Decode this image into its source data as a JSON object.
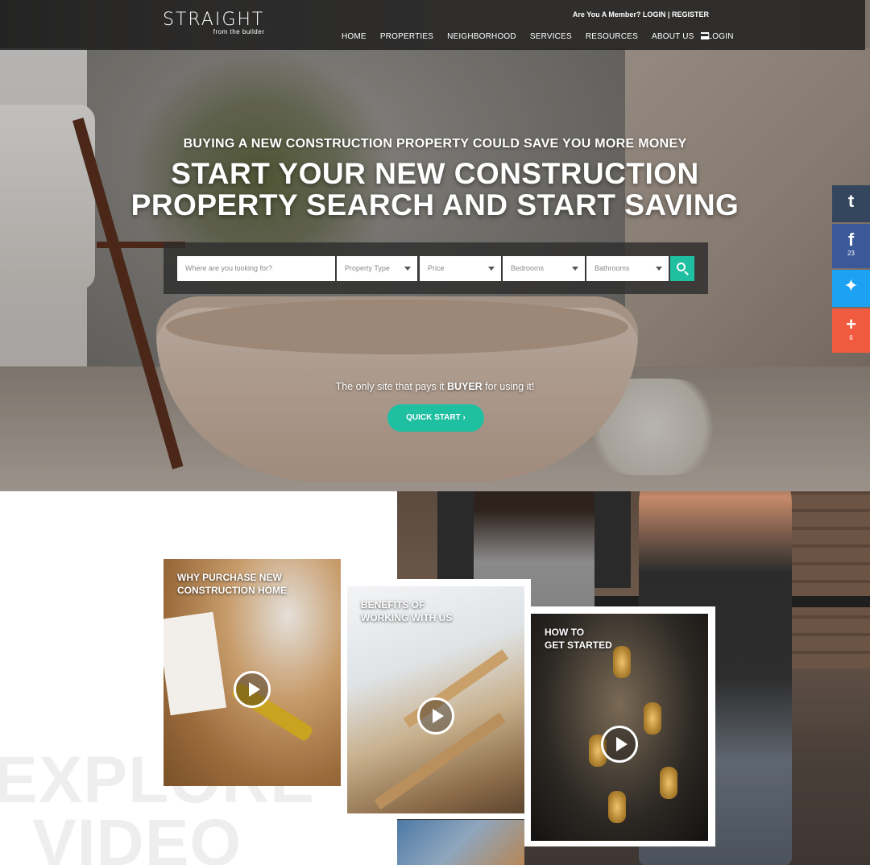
{
  "header": {
    "logo_word": "STRAIGHT",
    "logo_tagline": "from the builder",
    "member_prompt": "Are You A Member?",
    "login_link": "LOGIN",
    "separator": "|",
    "register_link": "REGISTER",
    "nav": [
      "HOME",
      "PROPERTIES",
      "NEIGHBORHOOD",
      "SERVICES",
      "RESOURCES",
      "ABOUT US",
      "LOGIN"
    ]
  },
  "hero": {
    "subtitle": "BUYING A NEW CONSTRUCTION PROPERTY COULD SAVE YOU MORE MONEY",
    "title_line1": "START YOUR NEW CONSTRUCTION",
    "title_line2": "PROPERTY SEARCH AND START SAVING",
    "promo_pre": "The only site that pays it ",
    "promo_bold": "BUYER",
    "promo_post": " for using it!",
    "cta": "QUICK START ›"
  },
  "search": {
    "location_placeholder": "Where are you looking for?",
    "property_type": "Property Type",
    "price": "Price",
    "bedrooms": "Bedrooms",
    "bathrooms": "Bathrooms",
    "button_icon": "search-icon"
  },
  "social": [
    {
      "name": "tumblr",
      "glyph": "t",
      "count": ""
    },
    {
      "name": "facebook",
      "glyph": "f",
      "count": "23"
    },
    {
      "name": "twitter",
      "glyph": "✦",
      "count": ""
    },
    {
      "name": "share",
      "glyph": "+",
      "count": "6"
    }
  ],
  "explore": {
    "line1": "EXPLORE",
    "line2": "VIDEO"
  },
  "videos": [
    {
      "title_line1": "WHY PURCHASE NEW",
      "title_line2": "CONSTRUCTION HOME"
    },
    {
      "title_line1": "BENEFITS OF",
      "title_line2": "WORKING WITH US"
    },
    {
      "title_line1": "HOW TO",
      "title_line2": "GET STARTED"
    }
  ],
  "colors": {
    "accent": "#1fbfa2",
    "header_bg": "#222222",
    "tumblr": "#34465d",
    "facebook": "#3b5998",
    "twitter": "#1da1f2",
    "share": "#f05a3e"
  }
}
